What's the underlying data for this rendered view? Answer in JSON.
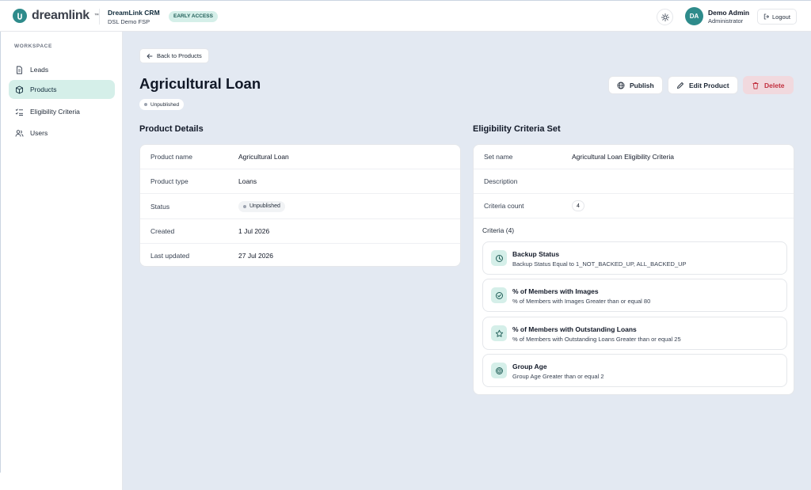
{
  "brand": {
    "name": "dreamlink",
    "tm": "™",
    "accent": "#2e8b8b"
  },
  "app": {
    "title": "DreamLink CRM",
    "subtitle": "DSL Demo FSP",
    "badge": "EARLY ACCESS"
  },
  "user": {
    "initials": "DA",
    "name": "Demo Admin",
    "role": "Administrator",
    "logout_label": "Logout"
  },
  "sidebar": {
    "section_label": "WORKSPACE",
    "items": [
      {
        "label": "Leads",
        "icon": "document-icon"
      },
      {
        "label": "Products",
        "icon": "box-icon",
        "active": true
      },
      {
        "label": "Eligibility Criteria",
        "icon": "checklist-icon"
      },
      {
        "label": "Users",
        "icon": "users-icon"
      }
    ]
  },
  "page": {
    "back_label": "Back to Products",
    "title": "Agricultural Loan",
    "status": "Unpublished",
    "actions": {
      "publish": "Publish",
      "edit": "Edit Product",
      "delete": "Delete"
    }
  },
  "product_details": {
    "title": "Product Details",
    "rows": [
      {
        "key": "Product name",
        "value": "Agricultural Loan"
      },
      {
        "key": "Product type",
        "value": "Loans"
      },
      {
        "key": "Status",
        "value": "Unpublished"
      },
      {
        "key": "Created",
        "value": "1 Jul 2026"
      },
      {
        "key": "Last updated",
        "value": "27 Jul 2026"
      }
    ]
  },
  "criteria_set": {
    "title": "Eligibility Criteria Set",
    "rows": [
      {
        "key": "Set name",
        "value": "Agricultural Loan Eligibility Criteria"
      },
      {
        "key": "Description",
        "value": ""
      },
      {
        "key": "Criteria count",
        "value": "4"
      }
    ],
    "criteria_heading": "Criteria (4)",
    "criteria": [
      {
        "name": "Backup Status",
        "desc": "Backup Status Equal to 1_NOT_BACKED_UP, ALL_BACKED_UP",
        "icon": "clock-icon"
      },
      {
        "name": "% of Members with Images",
        "desc": "% of Members with Images Greater than or equal 80",
        "icon": "check-circle-icon"
      },
      {
        "name": "% of Members with Outstanding Loans",
        "desc": "% of Members with Outstanding Loans Greater than or equal 25",
        "icon": "star-icon"
      },
      {
        "name": "Group Age",
        "desc": "Group Age Greater than or equal 2",
        "icon": "target-icon"
      }
    ]
  },
  "colors": {
    "main_bg": "#e3e9f2",
    "active_bg": "#d5efe9",
    "danger": "#c2303f"
  }
}
